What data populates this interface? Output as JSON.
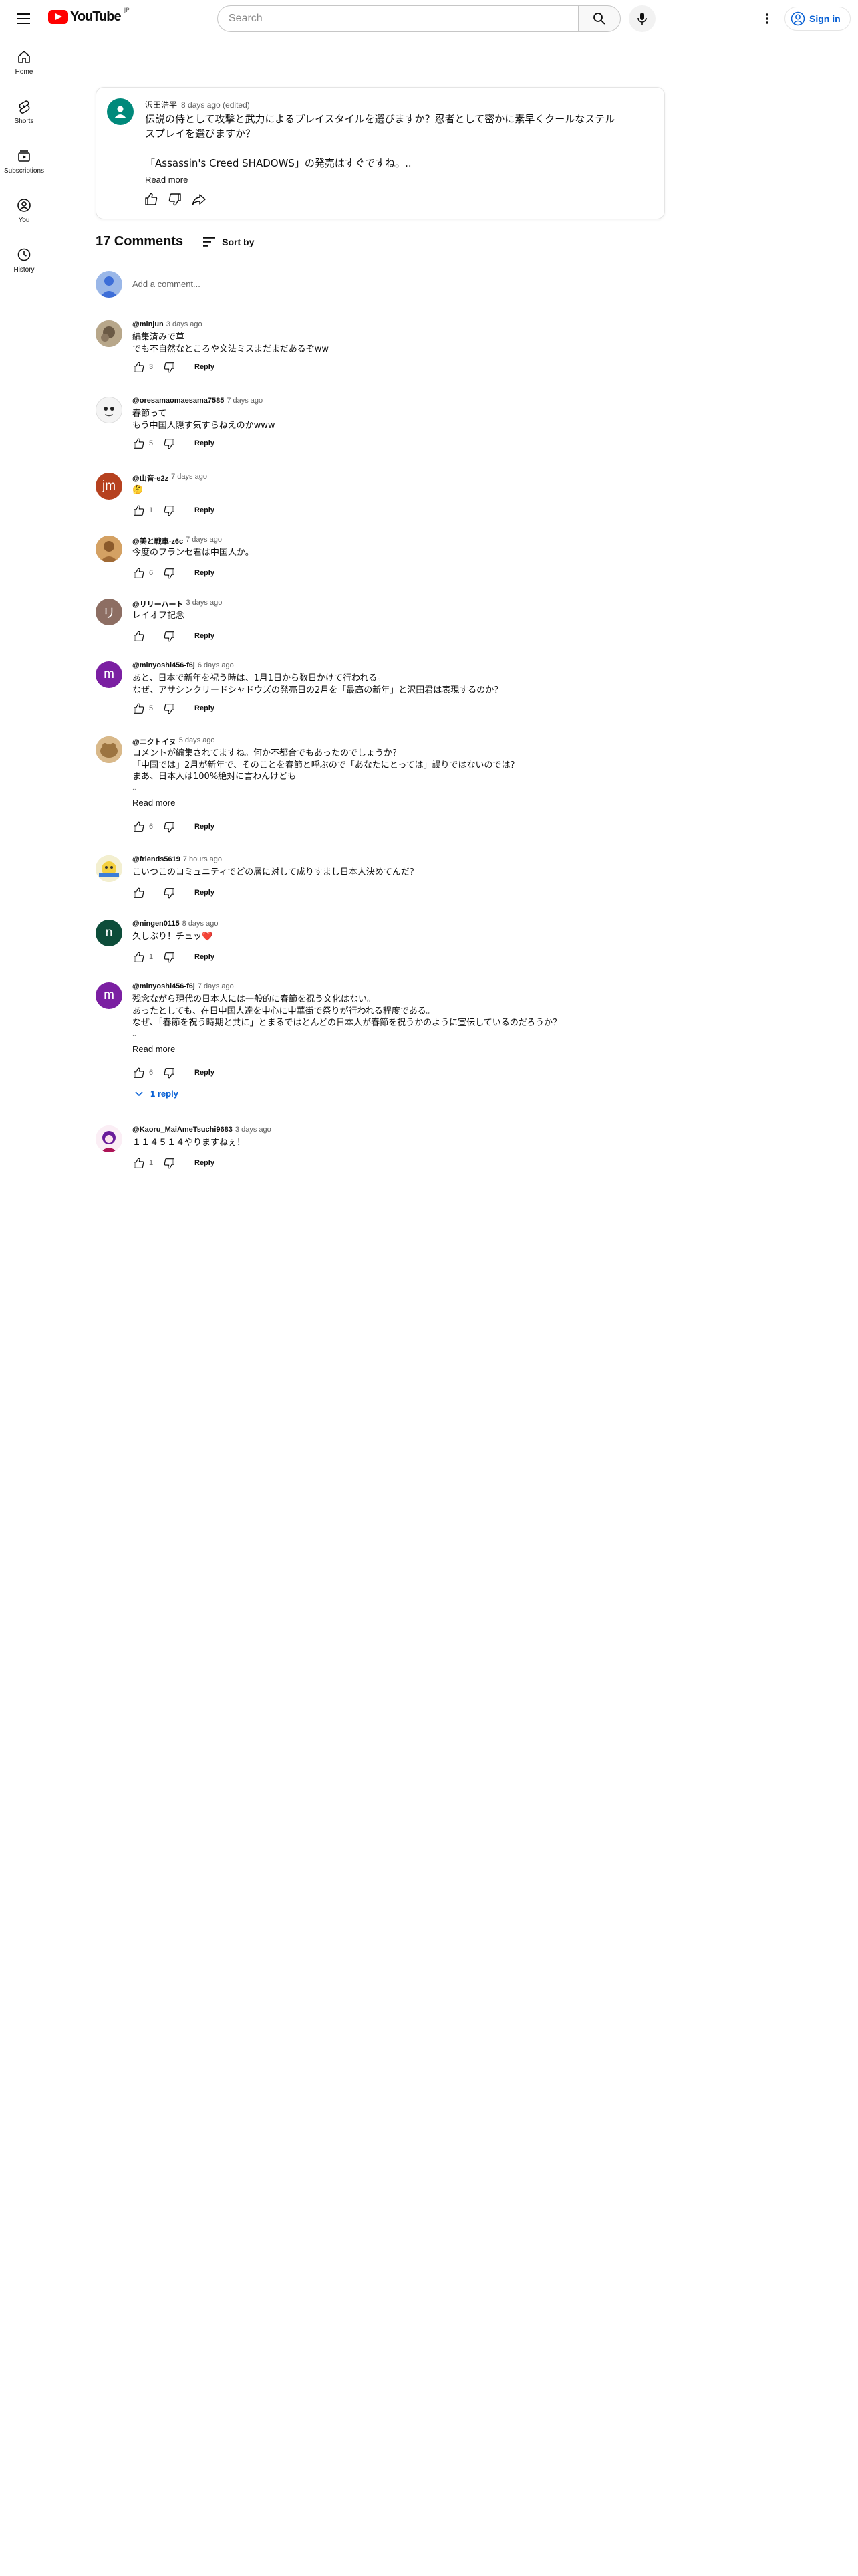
{
  "masthead": {
    "logo_text": "YouTube",
    "logo_country": "JP",
    "search_placeholder": "Search",
    "signin_label": "Sign in"
  },
  "sidenav": {
    "items": [
      {
        "label": "Home",
        "icon": "home-icon"
      },
      {
        "label": "Shorts",
        "icon": "shorts-icon"
      },
      {
        "label": "Subscriptions",
        "icon": "subscriptions-icon"
      },
      {
        "label": "You",
        "icon": "you-icon"
      },
      {
        "label": "History",
        "icon": "history-icon"
      }
    ]
  },
  "post": {
    "author": "沢田浩平",
    "time": "8 days ago (edited)",
    "lines": [
      "伝説の侍として攻撃と武力によるプレイスタイルを選びますか？忍者として密かに素早くクールなステル",
      "スプレイを選びますか？",
      "",
      "「Assassin's Creed SHADOWS」の発売はすぐですね。.."
    ],
    "read_more": "Read more"
  },
  "comments_header": {
    "count_label": "17 Comments",
    "sort_label": "Sort by",
    "add_placeholder": "Add a comment..."
  },
  "comments": [
    {
      "author": "@minjun",
      "time": "3 days ago",
      "lines": [
        "編集済みで草",
        "でも不自然なところや文法ミスまだまだあるぞww"
      ],
      "likes": "3",
      "reply_label": "Reply"
    },
    {
      "author": "@oresamaomaesama7585",
      "time": "7 days ago",
      "lines": [
        "春節って",
        "もう中国人隠す気すらねえのかwww"
      ],
      "likes": "5",
      "reply_label": "Reply"
    },
    {
      "author": "@山音-e2z",
      "time": "7 days ago",
      "lines": [
        "🤔"
      ],
      "likes": "1",
      "reply_label": "Reply"
    },
    {
      "author": "@美と戦車-z6c",
      "time": "7 days ago",
      "lines": [
        "今度のフランセ君は中国人か。"
      ],
      "likes": "6",
      "reply_label": "Reply"
    },
    {
      "author": "@リリーハート",
      "time": "3 days ago",
      "lines": [
        "レイオフ記念"
      ],
      "likes": "",
      "reply_label": "Reply"
    },
    {
      "author": "@minyoshi456-f6j",
      "time": "6 days ago",
      "lines": [
        "あと、日本で新年を祝う時は、1月1日から数日かけて行われる。",
        "なぜ、アサシンクリードシャドウズの発売日の2月を「最高の新年」と沢田君は表現するのか？"
      ],
      "likes": "5",
      "reply_label": "Reply"
    },
    {
      "author": "@ニクトイヌ",
      "time": "5 days ago",
      "lines": [
        "コメントが編集されてますね。何か不都合でもあったのでしょうか？",
        "「中国では」2月が新年で、そのことを春節と呼ぶので「あなたにとっては」誤りではないのでは？",
        "まあ、日本人は100%絶対に言わんけども",
        ".."
      ],
      "read_more": "Read more",
      "likes": "6",
      "reply_label": "Reply"
    },
    {
      "author": "@friends5619",
      "time": "7 hours ago",
      "lines": [
        "こいつこのコミュニティでどの層に対して成りすまし日本人決めてんだ？"
      ],
      "likes": "",
      "reply_label": "Reply"
    },
    {
      "author": "@ningen0115",
      "time": "8 days ago",
      "lines": [
        "久しぶり！チュッ❤️"
      ],
      "likes": "1",
      "reply_label": "Reply"
    },
    {
      "author": "@minyoshi456-f6j",
      "time": "7 days ago",
      "lines": [
        "残念ながら現代の日本人には一般的に春節を祝う文化はない。",
        "あったとしても、在日中国人達を中心に中華街で祭りが行われる程度である。",
        "なぜ、「春節を祝う時期と共に」とまるではとんどの日本人が春節を祝うかのように宣伝しているのだろうか？",
        ".."
      ],
      "read_more": "Read more",
      "likes": "6",
      "reply_label": "Reply",
      "replies_label": "1 reply"
    },
    {
      "author": "@Kaoru_MaiAmeTsuchi9683",
      "time": "3 days ago",
      "lines": [
        "１１４５１４やりますねぇ！"
      ],
      "likes": "1",
      "reply_label": "Reply"
    }
  ],
  "colors": {
    "brand_red": "#ff0000",
    "link_blue": "#065fd4",
    "post_avatar": "#00897b",
    "avatar_jm": "#b6411f",
    "avatar_ri": "#8d6e63",
    "avatar_m": "#7b1fa2",
    "avatar_n": "#0d4d3a"
  }
}
